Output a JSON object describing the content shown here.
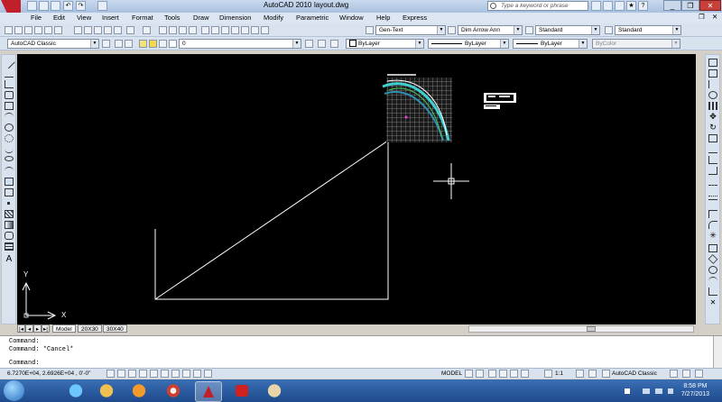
{
  "window": {
    "app_title": "AutoCAD 2010",
    "file_title": "layout.dwg",
    "search_placeholder": "Type a keyword or phrase"
  },
  "menu": [
    "File",
    "Edit",
    "View",
    "Insert",
    "Format",
    "Tools",
    "Draw",
    "Dimension",
    "Modify",
    "Parametric",
    "Window",
    "Help",
    "Express"
  ],
  "toolbar1": {
    "text_style": "Gen-Text",
    "dim_style": "Dim Arrow Ann",
    "table_style": "Standard",
    "multileader_style": "Standard"
  },
  "toolbar2": {
    "workspace": "AutoCAD Classic",
    "layer": "0",
    "color": "ByLayer",
    "linetype": "ByLayer",
    "lineweight": "ByLayer",
    "plotstyle": "ByColor"
  },
  "ucs": {
    "x_label": "X",
    "y_label": "Y"
  },
  "tabs": [
    "Model",
    "20X30",
    "30X40"
  ],
  "command": {
    "lines": [
      "Command:",
      "Command: *Cancel*"
    ],
    "prompt": "Command:"
  },
  "status": {
    "coordinates": "6.7270E+04, 2.6926E+04 , 0'-0\"",
    "mode": "MODEL",
    "scale": "1:1",
    "workspace": "AutoCAD Classic"
  },
  "clock": {
    "time": "8:58 PM",
    "date": "7/27/2013"
  },
  "colors": {
    "canvas": "#000000",
    "accent": "#c0202a",
    "drawing_lines": "#ffffff",
    "detail": "#3fd0d0"
  }
}
